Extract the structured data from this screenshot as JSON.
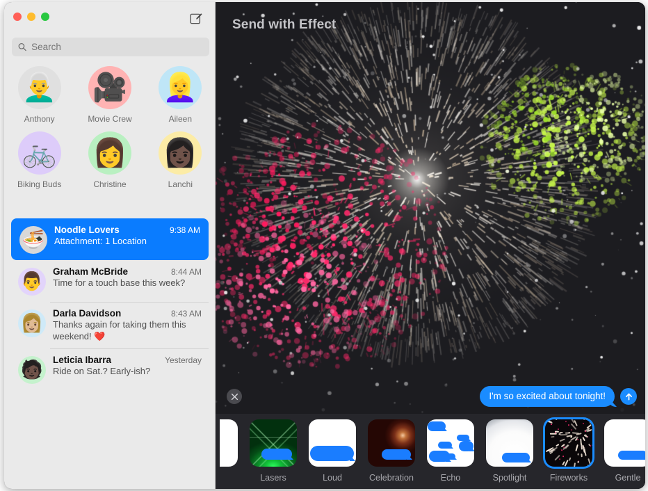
{
  "window": {
    "traffic_lights": [
      "close",
      "minimize",
      "zoom"
    ],
    "compose_icon": "compose-pencil-square-icon"
  },
  "sidebar": {
    "search": {
      "placeholder": "Search",
      "value": "",
      "icon": "search-icon"
    },
    "pinned": [
      {
        "name": "Anthony",
        "glyph": "👨‍🦳",
        "bg": "#e0e0e0"
      },
      {
        "name": "Movie Crew",
        "glyph": "🎥",
        "bg": "#ffb3b3"
      },
      {
        "name": "Aileen",
        "glyph": "👱‍♀️",
        "bg": "#bfe6f7"
      },
      {
        "name": "Biking Buds",
        "glyph": "🚲",
        "bg": "#ddccfa"
      },
      {
        "name": "Christine",
        "glyph": "👩",
        "bg": "#b9f0c1"
      },
      {
        "name": "Lanchi",
        "glyph": "👩🏿",
        "bg": "#fceca6"
      }
    ],
    "conversations": [
      {
        "name": "Noodle Lovers",
        "time": "9:38 AM",
        "preview": "Attachment: 1 Location",
        "selected": true,
        "avatar_glyph": "🍜",
        "avatar_bg": "#d8d8d8"
      },
      {
        "name": "Graham McBride",
        "time": "8:44 AM",
        "preview": "Time for a touch base this week?",
        "selected": false,
        "avatar_glyph": "👨",
        "avatar_bg": "#e2d4fb"
      },
      {
        "name": "Darla Davidson",
        "time": "8:43 AM",
        "preview": "Thanks again for taking them this weekend! ❤️",
        "selected": false,
        "avatar_glyph": "👩🏼",
        "avatar_bg": "#cfeaf8"
      },
      {
        "name": "Leticia Ibarra",
        "time": "Yesterday",
        "preview": "Ride on Sat.? Early-ish?",
        "selected": false,
        "avatar_glyph": "🧑🏿",
        "avatar_bg": "#c5f2cd"
      }
    ]
  },
  "effect_pane": {
    "title": "Send with Effect",
    "close_icon": "close-x-icon",
    "send_icon": "send-arrow-up-icon",
    "message_bubble": "I'm so excited about tonight!",
    "active_effect": "Fireworks",
    "accent_color": "#1a8cff",
    "background_color": "#1c1c20",
    "bar_color": "#26262b"
  },
  "effects": [
    {
      "label": "",
      "kind": "partial",
      "selected": false
    },
    {
      "label": "Lasers",
      "kind": "lasers",
      "selected": false
    },
    {
      "label": "Loud",
      "kind": "loud",
      "selected": false
    },
    {
      "label": "Celebration",
      "kind": "celebration",
      "selected": false
    },
    {
      "label": "Echo",
      "kind": "echo",
      "selected": false
    },
    {
      "label": "Spotlight",
      "kind": "spotlight",
      "selected": false
    },
    {
      "label": "Fireworks",
      "kind": "fireworks",
      "selected": true
    },
    {
      "label": "Gentle",
      "kind": "gentle",
      "selected": false
    }
  ]
}
